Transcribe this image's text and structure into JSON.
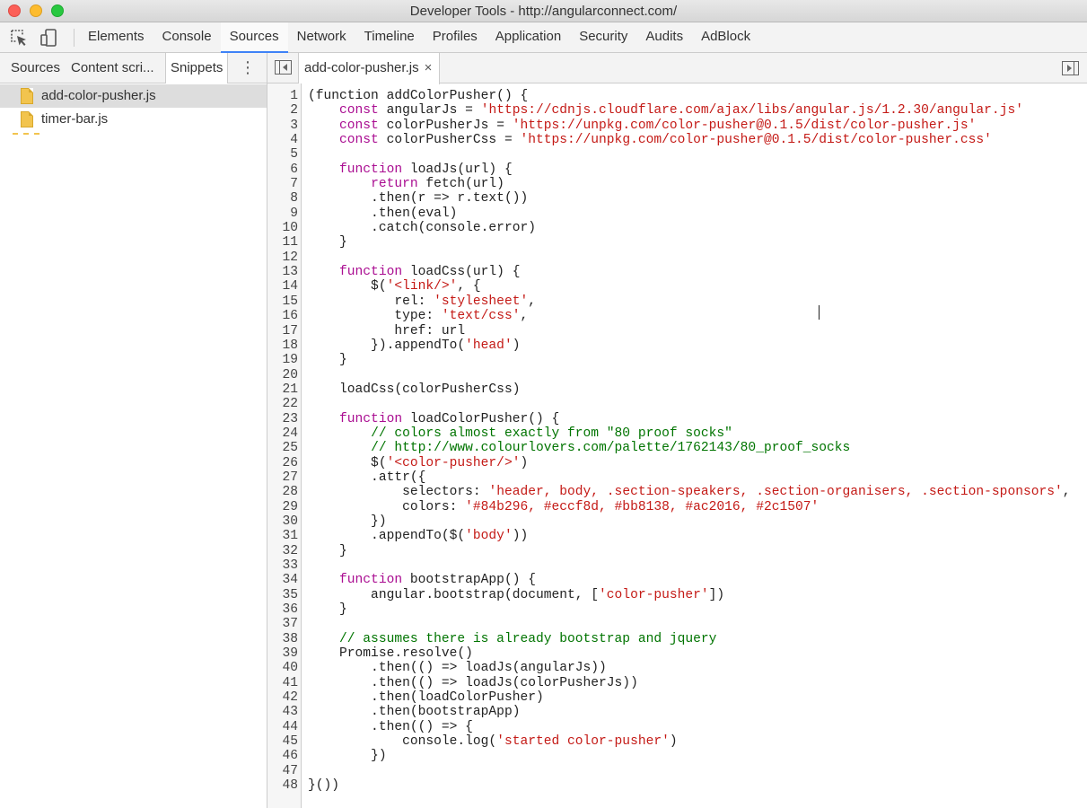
{
  "window": {
    "title": "Developer Tools - http://angularconnect.com/"
  },
  "toolbar": {
    "tabs": [
      {
        "label": "Elements"
      },
      {
        "label": "Console"
      },
      {
        "label": "Sources"
      },
      {
        "label": "Network"
      },
      {
        "label": "Timeline"
      },
      {
        "label": "Profiles"
      },
      {
        "label": "Application"
      },
      {
        "label": "Security"
      },
      {
        "label": "Audits"
      },
      {
        "label": "AdBlock"
      }
    ],
    "active_tab": "Sources"
  },
  "navigator": {
    "tabs": [
      {
        "label": "Sources"
      },
      {
        "label": "Content scri..."
      },
      {
        "label": "Snippets"
      }
    ],
    "active_tab": "Snippets",
    "more_label": "⋮",
    "files": [
      {
        "name": "add-color-pusher.js",
        "selected": true
      },
      {
        "name": "timer-bar.js",
        "selected": false
      }
    ]
  },
  "editor": {
    "open_file": "add-color-pusher.js",
    "close_label": "×",
    "lines": [
      [
        [
          "pl",
          "(function addColorPusher() {"
        ]
      ],
      [
        [
          "pl",
          "    "
        ],
        [
          "kw",
          "const"
        ],
        [
          "pl",
          " angularJs = "
        ],
        [
          "str",
          "'https://cdnjs.cloudflare.com/ajax/libs/angular.js/1.2.30/angular.js'"
        ]
      ],
      [
        [
          "pl",
          "    "
        ],
        [
          "kw",
          "const"
        ],
        [
          "pl",
          " colorPusherJs = "
        ],
        [
          "str",
          "'https://unpkg.com/color-pusher@0.1.5/dist/color-pusher.js'"
        ]
      ],
      [
        [
          "pl",
          "    "
        ],
        [
          "kw",
          "const"
        ],
        [
          "pl",
          " colorPusherCss = "
        ],
        [
          "str",
          "'https://unpkg.com/color-pusher@0.1.5/dist/color-pusher.css'"
        ]
      ],
      [
        [
          "pl",
          ""
        ]
      ],
      [
        [
          "pl",
          "    "
        ],
        [
          "kw",
          "function"
        ],
        [
          "pl",
          " loadJs(url) {"
        ]
      ],
      [
        [
          "pl",
          "        "
        ],
        [
          "kw",
          "return"
        ],
        [
          "pl",
          " fetch(url)"
        ]
      ],
      [
        [
          "pl",
          "        .then(r => r.text())"
        ]
      ],
      [
        [
          "pl",
          "        .then(eval)"
        ]
      ],
      [
        [
          "pl",
          "        .catch(console.error)"
        ]
      ],
      [
        [
          "pl",
          "    }"
        ]
      ],
      [
        [
          "pl",
          ""
        ]
      ],
      [
        [
          "pl",
          "    "
        ],
        [
          "kw",
          "function"
        ],
        [
          "pl",
          " loadCss(url) {"
        ]
      ],
      [
        [
          "pl",
          "        $("
        ],
        [
          "str",
          "'<link/>'"
        ],
        [
          "pl",
          ", {"
        ]
      ],
      [
        [
          "pl",
          "           rel: "
        ],
        [
          "str",
          "'stylesheet'"
        ],
        [
          "pl",
          ","
        ]
      ],
      [
        [
          "pl",
          "           type: "
        ],
        [
          "str",
          "'text/css'"
        ],
        [
          "pl",
          ","
        ]
      ],
      [
        [
          "pl",
          "           href: url"
        ]
      ],
      [
        [
          "pl",
          "        }).appendTo("
        ],
        [
          "str",
          "'head'"
        ],
        [
          "pl",
          ")"
        ]
      ],
      [
        [
          "pl",
          "    }"
        ]
      ],
      [
        [
          "pl",
          ""
        ]
      ],
      [
        [
          "pl",
          "    loadCss(colorPusherCss)"
        ]
      ],
      [
        [
          "pl",
          ""
        ]
      ],
      [
        [
          "pl",
          "    "
        ],
        [
          "kw",
          "function"
        ],
        [
          "pl",
          " loadColorPusher() {"
        ]
      ],
      [
        [
          "pl",
          "        "
        ],
        [
          "com",
          "// colors almost exactly from \"80 proof socks\""
        ]
      ],
      [
        [
          "pl",
          "        "
        ],
        [
          "com",
          "// http://www.colourlovers.com/palette/1762143/80_proof_socks"
        ]
      ],
      [
        [
          "pl",
          "        $("
        ],
        [
          "str",
          "'<color-pusher/>'"
        ],
        [
          "pl",
          ")"
        ]
      ],
      [
        [
          "pl",
          "        .attr({"
        ]
      ],
      [
        [
          "pl",
          "            selectors: "
        ],
        [
          "str",
          "'header, body, .section-speakers, .section-organisers, .section-sponsors'"
        ],
        [
          "pl",
          ","
        ]
      ],
      [
        [
          "pl",
          "            colors: "
        ],
        [
          "str",
          "'#84b296, #eccf8d, #bb8138, #ac2016, #2c1507'"
        ]
      ],
      [
        [
          "pl",
          "        })"
        ]
      ],
      [
        [
          "pl",
          "        .appendTo($("
        ],
        [
          "str",
          "'body'"
        ],
        [
          "pl",
          "))"
        ]
      ],
      [
        [
          "pl",
          "    }"
        ]
      ],
      [
        [
          "pl",
          ""
        ]
      ],
      [
        [
          "pl",
          "    "
        ],
        [
          "kw",
          "function"
        ],
        [
          "pl",
          " bootstrapApp() {"
        ]
      ],
      [
        [
          "pl",
          "        angular.bootstrap(document, ["
        ],
        [
          "str",
          "'color-pusher'"
        ],
        [
          "pl",
          "])"
        ]
      ],
      [
        [
          "pl",
          "    }"
        ]
      ],
      [
        [
          "pl",
          ""
        ]
      ],
      [
        [
          "pl",
          "    "
        ],
        [
          "com",
          "// assumes there is already bootstrap and jquery"
        ]
      ],
      [
        [
          "pl",
          "    Promise.resolve()"
        ]
      ],
      [
        [
          "pl",
          "        .then(() => loadJs(angularJs))"
        ]
      ],
      [
        [
          "pl",
          "        .then(() => loadJs(colorPusherJs))"
        ]
      ],
      [
        [
          "pl",
          "        .then(loadColorPusher)"
        ]
      ],
      [
        [
          "pl",
          "        .then(bootstrapApp)"
        ]
      ],
      [
        [
          "pl",
          "        .then(() => {"
        ]
      ],
      [
        [
          "pl",
          "            console.log("
        ],
        [
          "str",
          "'started color-pusher'"
        ],
        [
          "pl",
          ")"
        ]
      ],
      [
        [
          "pl",
          "        })"
        ]
      ],
      [
        [
          "pl",
          ""
        ]
      ],
      [
        [
          "pl",
          "}())"
        ]
      ]
    ]
  },
  "colors": {
    "keyword": "#aa0d91",
    "string": "#c41a16",
    "comment": "#007400",
    "accent_tab": "#3e82f7",
    "snippet_file_icon": "#f2c44e"
  },
  "icons": {
    "inspect": "inspect-element-icon",
    "device": "device-mode-icon",
    "toggle_navigator": "toggle-navigator-icon",
    "toggle_debugger": "toggle-debugger-icon",
    "file": "snippet-file-icon"
  }
}
